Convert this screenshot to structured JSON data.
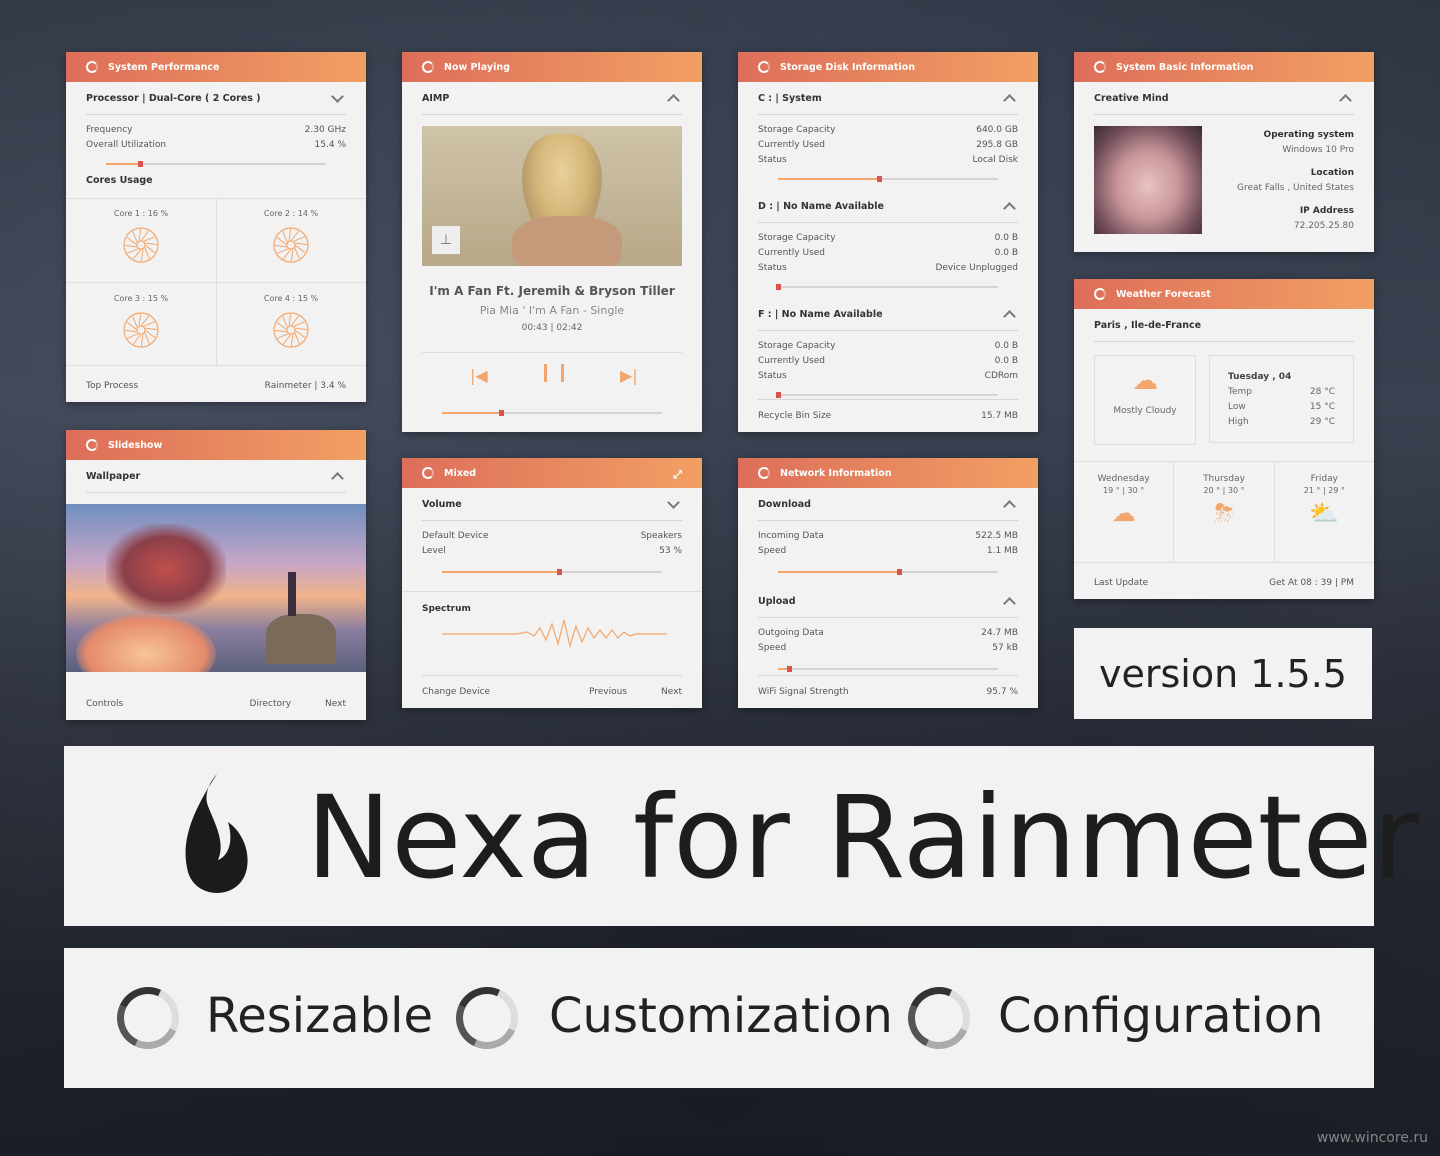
{
  "accent": "#f3a66b",
  "sysperf": {
    "title": "System Performance",
    "processor": "Processor  |  Dual-Core  ( 2  Cores )",
    "freq_label": "Frequency",
    "freq": "2.30 GHz",
    "util_label": "Overall Utilization",
    "util": "15.4 %",
    "util_level": 0.154,
    "cores_label": "Cores Usage",
    "cores": [
      "Core  1 :   16 %",
      "Core  2 :   14 %",
      "Core  3 :   15 %",
      "Core  4 :   15 %"
    ],
    "top_label": "Top Process",
    "top": "Rainmeter  |  3.4 %"
  },
  "slideshow": {
    "title": "Slideshow",
    "section": "Wallpaper",
    "controls": "Controls",
    "directory": "Directory",
    "next": "Next"
  },
  "nowplaying": {
    "title": "Now Playing",
    "player": "AIMP",
    "song": "I'm A Fan  Ft. Jeremih & Bryson Tiller",
    "artist": "Pia Mia  '  I'm A Fan - Single",
    "time": "00:43  |  02:42",
    "progress": 0.27
  },
  "mixed": {
    "title": "Mixed",
    "volume": "Volume",
    "device_label": "Default Device",
    "device": "Speakers",
    "level_label": "Level",
    "level": "53 %",
    "level_value": 0.53,
    "spectrum": "Spectrum",
    "change": "Change Device",
    "previous": "Previous",
    "next": "Next"
  },
  "storage": {
    "title": "Storage Disk Information",
    "cap_label": "Storage Capacity",
    "used_label": "Currently Used",
    "status_label": "Status",
    "drives": [
      {
        "name": "C :  |  System",
        "cap": "640.0 GB",
        "used": "295.8 GB",
        "status": "Local Disk",
        "fill": 0.46
      },
      {
        "name": "D :  |  No Name Available",
        "cap": "0.0 B",
        "used": "0.0 B",
        "status": "Device Unplugged",
        "fill": 0
      },
      {
        "name": "F :  |  No Name Available",
        "cap": "0.0 B",
        "used": "0.0 B",
        "status": "CDRom",
        "fill": 0
      }
    ],
    "recycle_label": "Recycle Bin Size",
    "recycle": "15.7 MB"
  },
  "network": {
    "title": "Network Information",
    "download": "Download",
    "in_label": "Incoming Data",
    "in": "522.5 MB",
    "speed_label": "Speed",
    "dspeed": "1.1 MB",
    "dl_level": 0.55,
    "upload": "Upload",
    "out_label": "Outgoing Data",
    "out": "24.7 MB",
    "uspeed": "57 kB",
    "ul_level": 0.05,
    "wifi_label": "WiFi Signal Strength",
    "wifi": "95.7 %"
  },
  "sysinfo": {
    "title": "System Basic Information",
    "name": "Creative Mind",
    "os_label": "Operating system",
    "os": "Windows 10 Pro",
    "loc_label": "Location",
    "loc": "Great Falls , United States",
    "ip_label": "IP Address",
    "ip": "72.205.25.80"
  },
  "weather": {
    "title": "Weather Forecast",
    "city": "Paris ,   Ile-de-France",
    "condition": "Mostly Cloudy",
    "day": "Tuesday ,  04",
    "temp_label": "Temp",
    "temp": "28 °C",
    "low_label": "Low",
    "low": "15 °C",
    "high_label": "High",
    "high": "29 °C",
    "forecast": [
      {
        "day": "Wednesday",
        "range": "19 °  |  30 °"
      },
      {
        "day": "Thursday",
        "range": "20 °  |  30 °"
      },
      {
        "day": "Friday",
        "range": "21 °  |  29 °"
      }
    ],
    "last_label": "Last Update",
    "last": "Get At  08 : 39  |  PM"
  },
  "version": "version 1.5.5",
  "banner": "Nexa for Rainmeter",
  "features": [
    "Resizable",
    "Customization",
    "Configuration"
  ],
  "watermark": "www.wincore.ru"
}
